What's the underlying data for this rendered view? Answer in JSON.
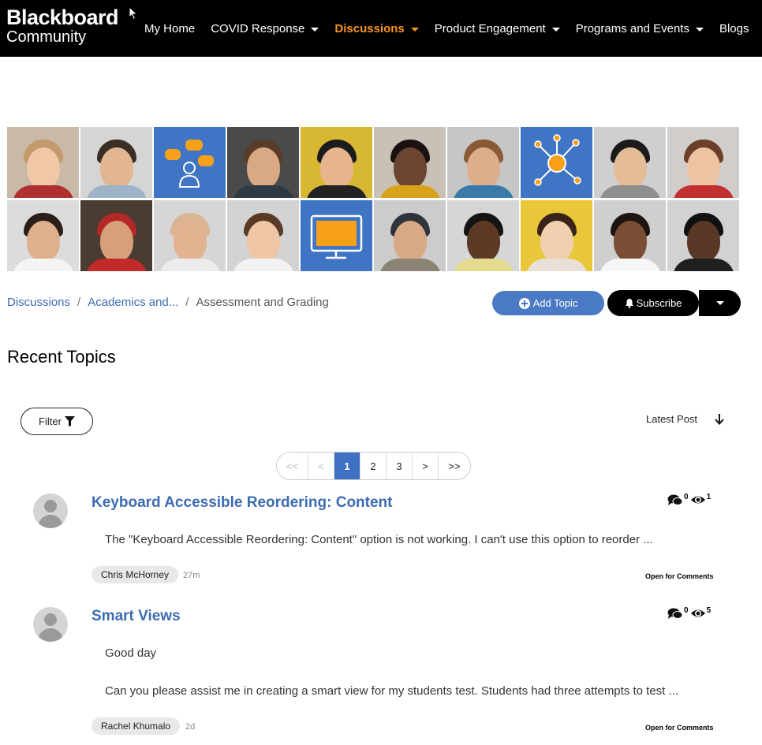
{
  "header": {
    "logo_line1": "Blackboard",
    "logo_line2": "Community",
    "nav": [
      {
        "label": "My Home"
      },
      {
        "label": "COVID Response"
      },
      {
        "label": "Discussions"
      },
      {
        "label": "Product Engagement"
      },
      {
        "label": "Programs and Events"
      },
      {
        "label": "Blogs"
      }
    ],
    "active_color": "#f7941d"
  },
  "breadcrumb": {
    "items": [
      "Discussions",
      "Academics and...",
      "Assessment and Grading"
    ],
    "separator": "/"
  },
  "actions": {
    "add_topic": "Add Topic",
    "subscribe": "Subscribe"
  },
  "section_title": "Recent Topics",
  "filter": {
    "label": "Filter"
  },
  "sort": {
    "label": "Latest Post"
  },
  "pagination": {
    "items": [
      "<<",
      "<",
      "1",
      "2",
      "3",
      ">",
      ">>"
    ],
    "current_page": "1"
  },
  "topics": [
    {
      "title": "Keyboard Accessible Reordering: Content",
      "excerpt": "The \"Keyboard Accessible Reordering: Content\" option is not working. I can't use this option to reorder ...",
      "replies": "0",
      "views": "1",
      "author": "Chris McHorney",
      "time": "27m",
      "status": "Open for Comments"
    },
    {
      "title": "Smart Views",
      "excerpt_line1": "Good day",
      "excerpt": "Can you please assist me in creating a smart view for my students test. Students had three attempts to test ...",
      "replies": "0",
      "views": "5",
      "author": "Rachel Khumalo",
      "time": "2d",
      "status": "Open for Comments"
    }
  ],
  "colors": {
    "link": "#3d6cb3",
    "primary_button": "#4a7ac4",
    "banner_blue": "#3f75c4",
    "accent_orange": "#f7941d"
  }
}
